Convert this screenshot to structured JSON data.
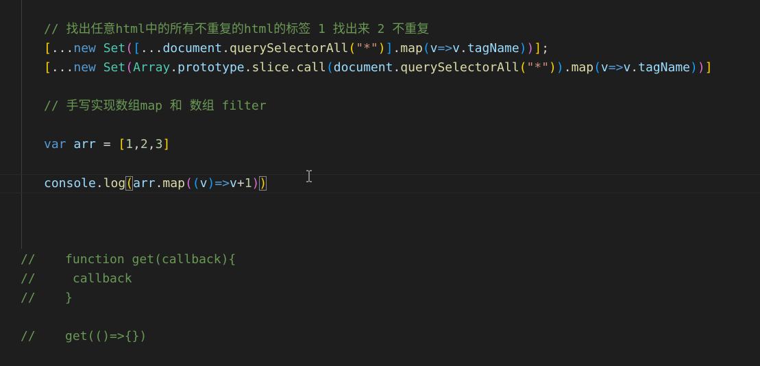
{
  "editor": {
    "language": "javascript",
    "theme": "dark",
    "lines": {
      "l1": {
        "comment": "// 找出任意html中的所有不重复的html的标签 1 找出来 2 不重复"
      },
      "l2": {
        "t1": "[",
        "t2": "...",
        "t3": "new",
        "t4": "Set",
        "t5": "(",
        "t6": "[",
        "t7": "...",
        "t8": "document",
        "t9": ".",
        "t10": "querySelectorAll",
        "t11": "(",
        "t12": "\"*\"",
        "t13": ")",
        "t14": "]",
        "t15": ".",
        "t16": "map",
        "t17": "(",
        "t18": "v",
        "t19": "=>",
        "t20": "v",
        "t21": ".",
        "t22": "tagName",
        "t23": ")",
        "t24": ")",
        "t25": "]",
        "t26": ";"
      },
      "l3": {
        "t1": "[",
        "t2": "...",
        "t3": "new",
        "t4": "Set",
        "t5": "(",
        "t6": "Array",
        "t7": ".",
        "t8": "prototype",
        "t9": ".",
        "t10": "slice",
        "t11": ".",
        "t12": "call",
        "t13": "(",
        "t14": "document",
        "t15": ".",
        "t16": "querySelectorAll",
        "t17": "(",
        "t18": "\"*\"",
        "t19": ")",
        "t20": ")",
        "t21": ".",
        "t22": "map",
        "t23": "(",
        "t24": "v",
        "t25": "=>",
        "t26": "v",
        "t27": ".",
        "t28": "tagName",
        "t29": ")",
        "t30": ")",
        "t31": "]"
      },
      "l4": {
        "comment": "// 手写实现数组map 和 数组 filter"
      },
      "l5": {
        "t1": "var",
        "t2": " ",
        "t3": "arr",
        "t4": " = ",
        "t5": "[",
        "t6": "1",
        "t7": ",",
        "t8": "2",
        "t9": ",",
        "t10": "3",
        "t11": "]"
      },
      "l6": {
        "t1": "console",
        "t2": ".",
        "t3": "log",
        "t4": "(",
        "t5": "arr",
        "t6": ".",
        "t7": "map",
        "t8": "(",
        "t9": "(",
        "t10": "v",
        "t11": ")",
        "t12": "=>",
        "t13": "v",
        "t14": "+",
        "t15": "1",
        "t16": ")",
        "t17": ")"
      },
      "l7": {
        "comment": "//    function get(callback){"
      },
      "l8": {
        "comment": "//     callback"
      },
      "l9": {
        "comment": "//    }"
      },
      "l10": {
        "comment": "//    get(()=>{})"
      }
    },
    "colors": {
      "background": "#1e1e1e",
      "comment": "#6a9955",
      "keyword": "#569cd6",
      "variable": "#9cdcfe",
      "function": "#dcdcaa",
      "class": "#4ec9b0",
      "string": "#ce9178",
      "number": "#b5cea8",
      "bracket_level_1": "#ffd700",
      "bracket_level_2": "#da70d6",
      "bracket_level_3": "#179fff"
    },
    "cursor_icon": "i-beam-cursor-icon"
  }
}
